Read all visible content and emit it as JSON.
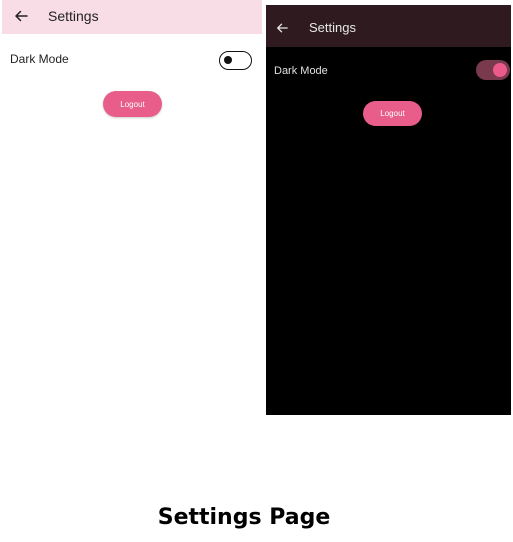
{
  "light_screen": {
    "appbar": {
      "title": "Settings",
      "back_icon": "arrow-left-icon"
    },
    "dark_mode_row": {
      "label": "Dark Mode",
      "enabled": false
    },
    "logout_label": "Logout",
    "colors": {
      "appbar": "#f9dde6",
      "background": "#ffffff",
      "accent": "#e85d8a"
    }
  },
  "dark_screen": {
    "appbar": {
      "title": "Settings",
      "back_icon": "arrow-left-icon"
    },
    "dark_mode_row": {
      "label": "Dark Mode",
      "enabled": true
    },
    "logout_label": "Logout",
    "colors": {
      "appbar": "#2e1a1f",
      "background": "#000000",
      "accent": "#e85d8a"
    }
  },
  "caption": "Settings Page"
}
